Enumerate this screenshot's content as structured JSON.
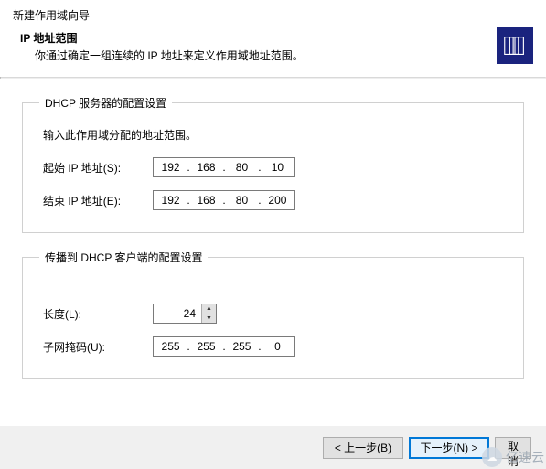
{
  "window_title": "新建作用域向导",
  "header": {
    "title": "IP 地址范围",
    "desc": "你通过确定一组连续的 IP 地址来定义作用域地址范围。"
  },
  "group1": {
    "legend": "DHCP 服务器的配置设置",
    "hint": "输入此作用域分配的地址范围。",
    "start_label": "起始 IP 地址(S):",
    "end_label": "结束 IP 地址(E):",
    "start_ip": {
      "o1": "192",
      "o2": "168",
      "o3": "80",
      "o4": "10"
    },
    "end_ip": {
      "o1": "192",
      "o2": "168",
      "o3": "80",
      "o4": "200"
    }
  },
  "group2": {
    "legend": "传播到 DHCP 客户端的配置设置",
    "length_label": "长度(L):",
    "length_value": "24",
    "mask_label": "子网掩码(U):",
    "mask": {
      "o1": "255",
      "o2": "255",
      "o3": "255",
      "o4": "0"
    }
  },
  "footer": {
    "back": "< 上一步(B)",
    "next": "下一步(N) >",
    "cancel": "取消"
  },
  "watermark": "亿速云",
  "dot": "."
}
